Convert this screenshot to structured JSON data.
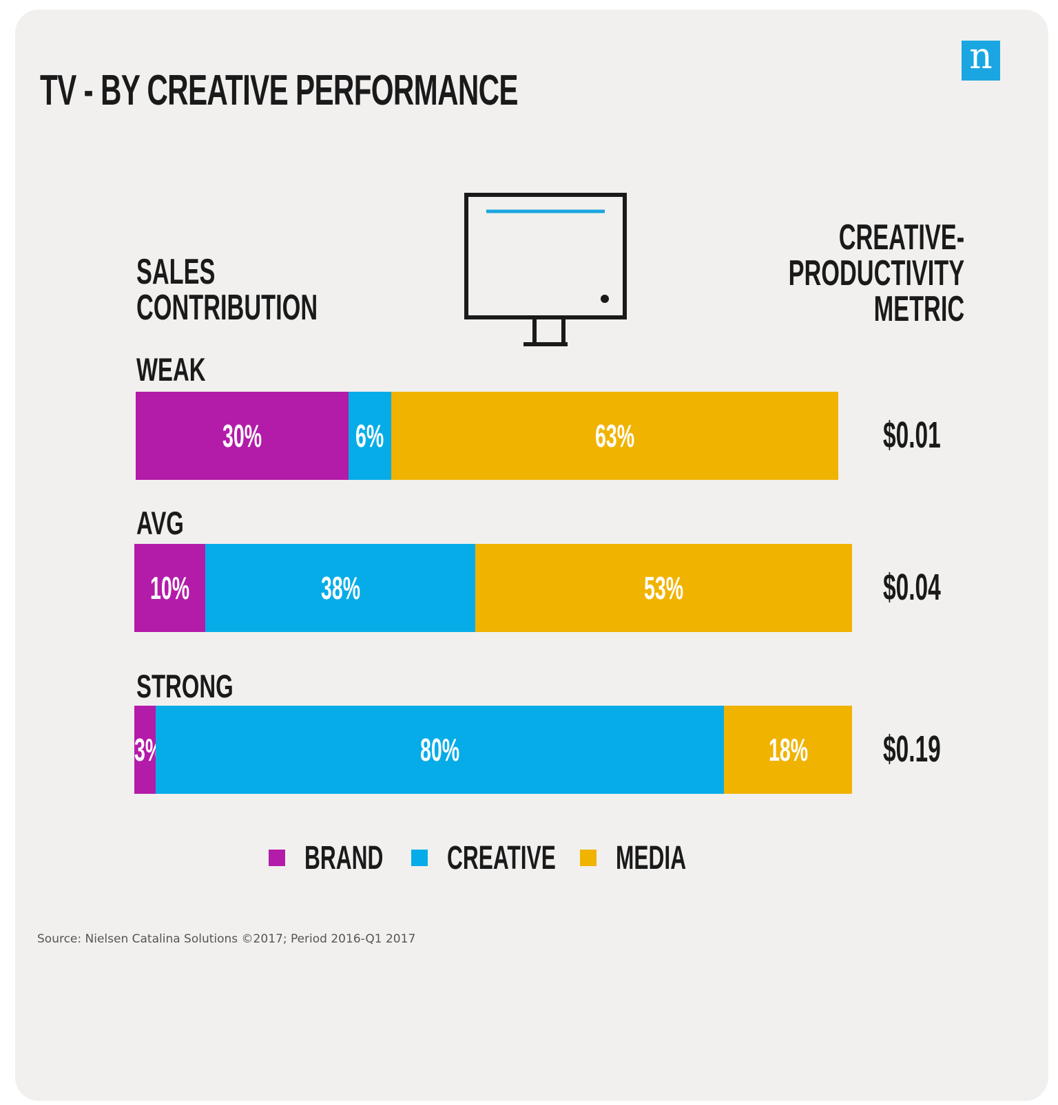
{
  "title": "TV - BY CREATIVE PERFORMANCE",
  "logo_letter": "n",
  "left_header": [
    "SALES",
    "CONTRIBUTION"
  ],
  "right_header": [
    "CREATIVE-",
    "PRODUCTIVITY",
    "METRIC"
  ],
  "source": "Source: Nielsen Catalina Solutions ©2017; Period 2016-Q1 2017",
  "colors": {
    "BRAND": "#b31ba9",
    "CREATIVE": "#06ace8",
    "MEDIA": "#f0b300"
  },
  "chart_data": {
    "type": "bar",
    "orientation": "horizontal",
    "stacked": true,
    "categories": [
      "WEAK",
      "AVG",
      "STRONG"
    ],
    "series": [
      {
        "name": "BRAND",
        "values": [
          30,
          10,
          3
        ],
        "labels": [
          "30%",
          "10%",
          "3%"
        ]
      },
      {
        "name": "CREATIVE",
        "values": [
          6,
          38,
          80
        ],
        "labels": [
          "6%",
          "38%",
          "80%"
        ]
      },
      {
        "name": "MEDIA",
        "values": [
          63,
          53,
          18
        ],
        "labels": [
          "63%",
          "53%",
          "18%"
        ]
      }
    ],
    "metric": [
      "$0.01",
      "$0.04",
      "$0.19"
    ],
    "legend": [
      "BRAND",
      "CREATIVE",
      "MEDIA"
    ],
    "legend_position": "bottom"
  }
}
